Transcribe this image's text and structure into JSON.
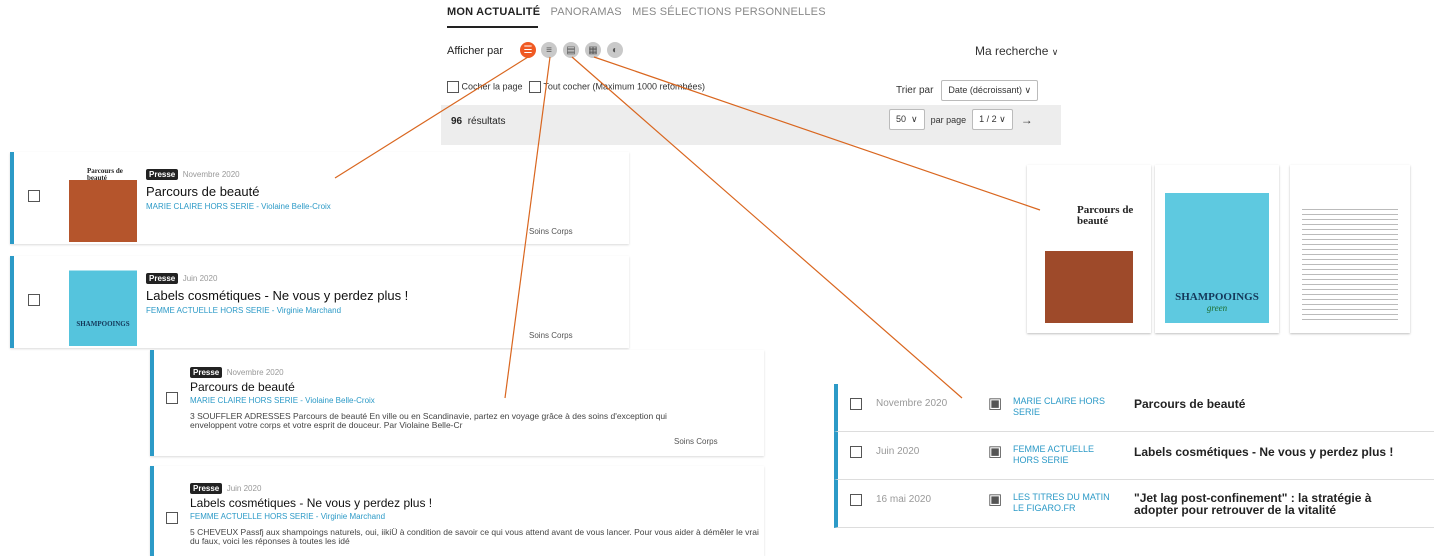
{
  "tabs": [
    "MON ACTUALITÉ",
    "PANORAMAS",
    "MES SÉLECTIONS PERSONNELLES"
  ],
  "afficher_par": "Afficher par",
  "view_icons": [
    "list-detail",
    "list-compact",
    "list-table",
    "grid",
    "chart"
  ],
  "ma_recherche": "Ma recherche",
  "cocher_page": "Cocher la page",
  "tout_cocher": "Tout cocher (Maximum 1000 retombées)",
  "trier_par": "Trier par",
  "sort_option": "Date (décroissant)",
  "results_count": "96",
  "results_label": "résultats",
  "per_page_value": "50",
  "per_page_label": "par page",
  "page_value": "1 / 2",
  "articles": [
    {
      "badge": "Presse",
      "date": "Novembre 2020",
      "title": "Parcours de beauté",
      "source": "MARIE CLAIRE HORS SERIE - Violaine Belle-Croix",
      "tag": "Soins Corps",
      "excerpt": "3 SOUFFLER ADRESSES Parcours de beauté En ville ou en Scandinavie, partez en voyage grâce à des soins d'exception qui enveloppent votre corps et votre esprit de douceur. Par Violaine Belle-Cr"
    },
    {
      "badge": "Presse",
      "date": "Juin 2020",
      "title": "Labels cosmétiques - Ne vous y perdez plus !",
      "source": "FEMME ACTUELLE HORS SERIE - Virginie Marchand",
      "tag": "Soins Corps",
      "excerpt": "5 CHEVEUX Passfj aux shampoings naturels, oui, iikiÜ à condition de savoir ce qui vous attend avant de vous lancer. Pour vous aider à démêler le vrai du faux, voici les réponses à toutes les idé"
    }
  ],
  "table_rows": [
    {
      "date": "Novembre 2020",
      "source_line1": "MARIE CLAIRE HORS",
      "source_line2": "SERIE",
      "title": "Parcours de beauté"
    },
    {
      "date": "Juin 2020",
      "source_line1": "FEMME ACTUELLE",
      "source_line2": "HORS SERIE",
      "title": "Labels cosmétiques - Ne vous y perdez plus !"
    },
    {
      "date": "16 mai 2020",
      "source_line1": "LES TITRES DU MATIN",
      "source_line2": "LE FIGARO.FR",
      "title": "\"Jet lag post-confinement\" : la stratégie à",
      "title2": "adopter pour retrouver de la vitalité"
    }
  ],
  "thumb_texts": {
    "parcours": "Parcours de beauté",
    "shampoo": "SHAMPOOINGS",
    "green": "green"
  },
  "colors": {
    "accent": "#f05a23",
    "blue": "#2c9ac7",
    "line": "#d9661f"
  }
}
